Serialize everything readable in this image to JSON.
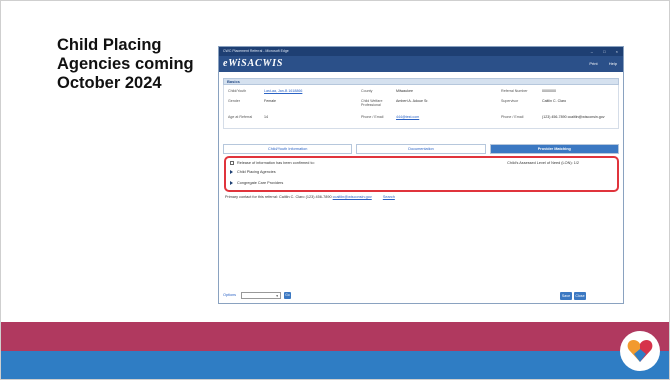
{
  "slide": {
    "title": "Child Placing Agencies coming October 2024",
    "brand_colors": {
      "band_top": "#b0395f",
      "band_bottom": "#2f7dc4",
      "logo_orange": "#f29a2e",
      "logo_red": "#d6334b",
      "logo_blue": "#2f7dc4"
    }
  },
  "window": {
    "title": "CWC Placement Referral - Microsoft Edge",
    "controls": [
      "–",
      "□",
      "×"
    ],
    "brand": "eWiSACWIS",
    "header_links": [
      "Print",
      "Help"
    ]
  },
  "basic": {
    "section_label": "Basics",
    "fields": [
      {
        "label": "Child/Youth",
        "value": "Last-aa, Jan-B 1618866"
      },
      {
        "label": "County",
        "value": "Milwaukee"
      },
      {
        "label": "Referral Number",
        "value": "0000000"
      },
      {
        "label": "Gender",
        "value": "Female"
      },
      {
        "label": "Child Welfare Professional",
        "value": "Ambert A. Adoue Sr."
      },
      {
        "label": "Supervisor",
        "value": "Caitlin C. Claro"
      },
      {
        "label": "Age at Referral",
        "value": "14"
      },
      {
        "label": "Phone / Email",
        "value": "444@test.com"
      },
      {
        "label": "Phone / Email",
        "value": "(123) 456-7890 ccaitlin@wisconsin.gov"
      }
    ]
  },
  "tabs": [
    {
      "label": "Child/Youth Information",
      "active": false
    },
    {
      "label": "Documentation",
      "active": false
    },
    {
      "label": "Provider Matching",
      "active": true
    }
  ],
  "panel": {
    "release_label": "Release of information has been confirmed to:",
    "assessment": "Child's Assessed Level of Need (LON): 1/2",
    "items": [
      "Child Placing Agencies",
      "Congregate Care Providers"
    ]
  },
  "primary_contact": {
    "text": "Primary contact for this referral: Caitlin C. Claro (123) 456-7890",
    "email": "ccaitlin@wisconsin.gov",
    "search_link": "Search"
  },
  "footer": {
    "options_label": "Options",
    "select_value": "",
    "go_label": "Go",
    "save_label": "Save",
    "close_label": "Close"
  }
}
